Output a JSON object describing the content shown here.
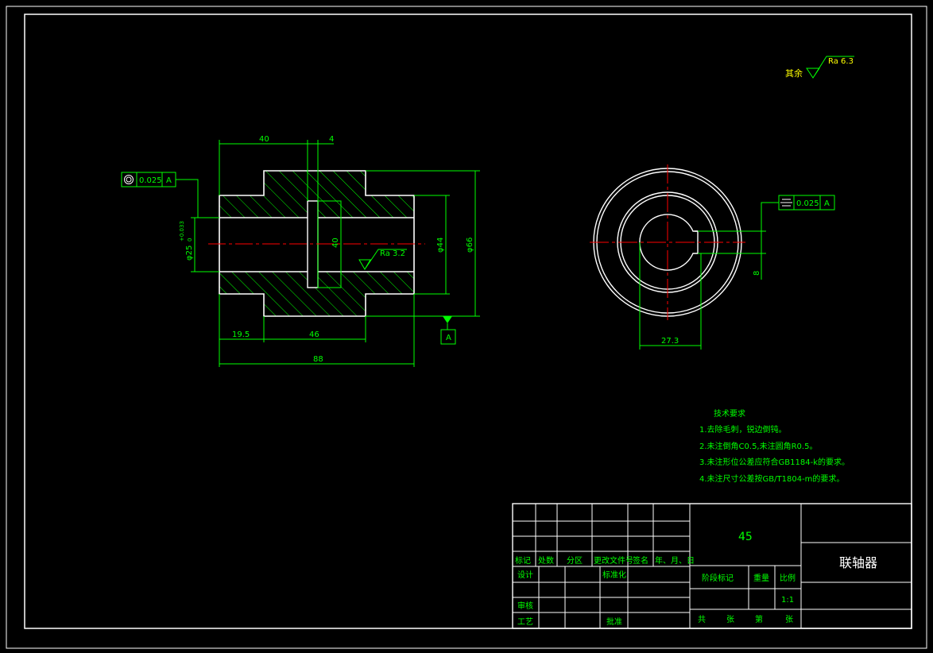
{
  "surface_finish_general": {
    "label": "其余",
    "value": "Ra 6.3"
  },
  "front_view": {
    "dims": {
      "top_left": "40",
      "top_right": "4",
      "bore_dia_main": "φ25",
      "bore_tol_upper": "+0.033",
      "bore_tol_lower": "0",
      "key_height": "40",
      "outer_small": "φ44",
      "outer_large": "φ66",
      "bottom_left": "19.5",
      "bottom_mid": "46",
      "total": "88"
    },
    "roughness": "Ra 3.2",
    "concentricity": {
      "value": "0.025",
      "datum": "A"
    },
    "datum_label": "A"
  },
  "side_view": {
    "symmetry": {
      "value": "0.025",
      "datum": "A"
    },
    "dims": {
      "keyway_width": "8",
      "keyway_depth": "27.3"
    }
  },
  "tech_requirements": {
    "title": "技术要求",
    "items": [
      "1.去除毛刺，锐边倒钝。",
      "2.未注倒角C0.5,未注圆角R0.5。",
      "3.未注形位公差应符合GB1184-k的要求。",
      "4.未注尺寸公差按GB/T1804-m的要求。"
    ]
  },
  "title_block": {
    "material": "45",
    "part_name": "联轴器",
    "headers": [
      "标记",
      "处数",
      "分区",
      "更改文件号",
      "签名",
      "年、月、日"
    ],
    "design": "设计",
    "standardization": "标准化",
    "review": "审核",
    "process": "工艺",
    "approval": "批准",
    "stage_mark": "阶段标记",
    "weight": "重量",
    "scale": "比例",
    "scale_value": "1:1",
    "sheet_total": "共",
    "sheet_unit": "张",
    "sheet_number": "第",
    "sheet_unit2": "张"
  }
}
